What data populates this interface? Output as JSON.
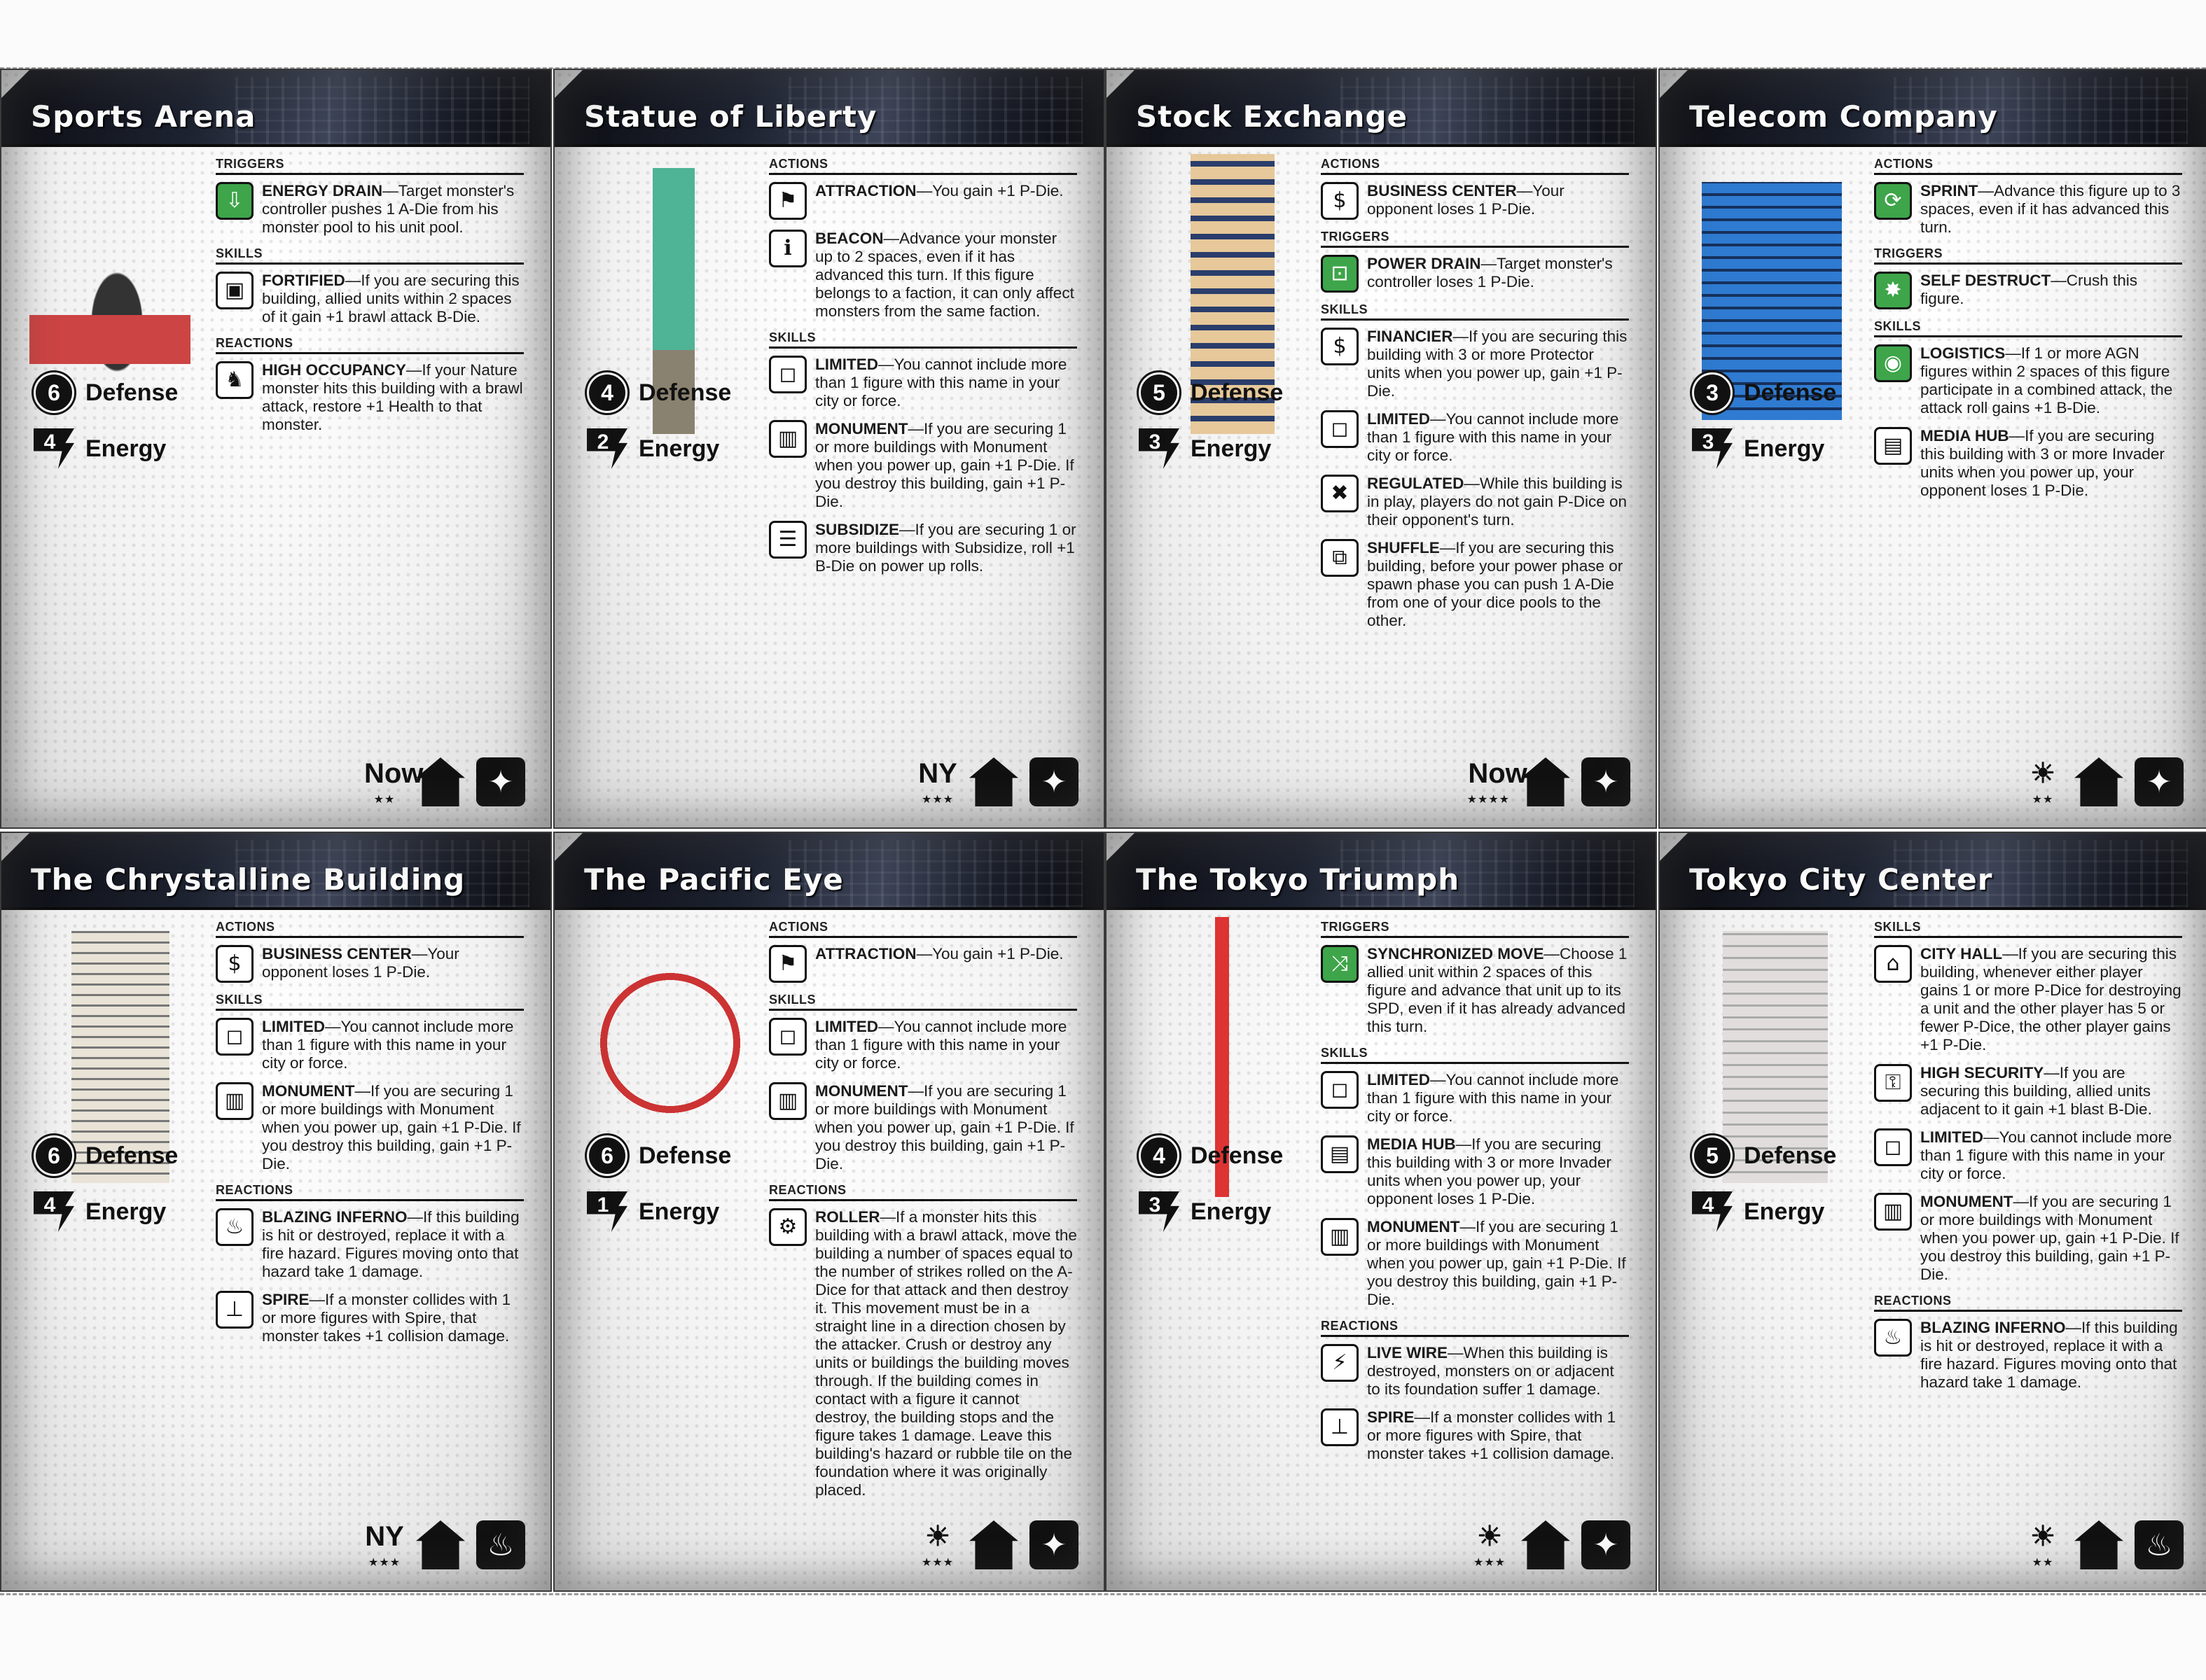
{
  "cards": [
    {
      "title": "Sports Arena",
      "defense": "6",
      "defense_label": "Defense",
      "energy": "4",
      "energy_label": "Energy",
      "sections": [
        {
          "head": "TRIGGERS",
          "abilities": [
            {
              "icon": "energy-drain-icon",
              "name": "ENERGY DRAIN",
              "text": "—Target monster's controller pushes 1 A-Die from his monster pool to his unit pool."
            }
          ]
        },
        {
          "head": "SKILLS",
          "abilities": [
            {
              "icon": "fortified-icon",
              "name": "FORTIFIED",
              "text": "—If you are securing this building, allied units within 2 spaces of it gain +1 brawl attack B-Die."
            }
          ]
        },
        {
          "head": "REACTIONS",
          "abilities": [
            {
              "icon": "high-occupancy-icon",
              "name": "HIGH OCCUPANCY",
              "text": "—If your Nature monster hits this building with a brawl attack, restore +1 Health to that monster."
            }
          ]
        }
      ],
      "set_glyph": "Now",
      "set_stars": "★★",
      "type_icon": "house",
      "tile_icon": "rubble-icon"
    },
    {
      "title": "Statue of Liberty",
      "defense": "4",
      "defense_label": "Defense",
      "energy": "2",
      "energy_label": "Energy",
      "sections": [
        {
          "head": "ACTIONS",
          "abilities": [
            {
              "icon": "attraction-icon",
              "name": "ATTRACTION",
              "text": "—You gain +1 P-Die."
            },
            {
              "icon": "beacon-icon",
              "name": "BEACON",
              "text": "—Advance your monster up to 2 spaces, even if it has advanced this turn. If this figure belongs to a faction, it can only affect monsters from the same faction."
            }
          ]
        },
        {
          "head": "SKILLS",
          "abilities": [
            {
              "icon": "limited-icon",
              "name": "LIMITED",
              "text": "—You cannot include more than 1 figure with this name in your city or force."
            },
            {
              "icon": "monument-icon",
              "name": "MONUMENT",
              "text": "—If you are securing 1 or more buildings with Monument when you power up, gain +1 P-Die. If you destroy this building, gain +1 P-Die."
            },
            {
              "icon": "subsidize-icon",
              "name": "SUBSIDIZE",
              "text": "—If you are securing 1 or more buildings with Subsidize, roll +1 B-Die on power up rolls."
            }
          ]
        }
      ],
      "set_glyph": "NY",
      "set_stars": "★★★",
      "type_icon": "house",
      "tile_icon": "rubble-icon"
    },
    {
      "title": "Stock Exchange",
      "defense": "5",
      "defense_label": "Defense",
      "energy": "3",
      "energy_label": "Energy",
      "sections": [
        {
          "head": "ACTIONS",
          "abilities": [
            {
              "icon": "business-center-icon",
              "name": "BUSINESS CENTER",
              "text": "—Your opponent loses 1 P-Die."
            }
          ]
        },
        {
          "head": "TRIGGERS",
          "abilities": [
            {
              "icon": "power-drain-icon",
              "name": "POWER DRAIN",
              "text": "—Target monster's controller loses 1 P-Die."
            }
          ]
        },
        {
          "head": "SKILLS",
          "abilities": [
            {
              "icon": "financier-icon",
              "name": "FINANCIER",
              "text": "—If you are securing this building with 3 or more Protector units when you power up, gain +1 P-Die."
            },
            {
              "icon": "limited-icon",
              "name": "LIMITED",
              "text": "—You cannot include more than 1 figure with this name in your city or force."
            },
            {
              "icon": "regulated-icon",
              "name": "REGULATED",
              "text": "—While this building is in play, players do not gain P-Dice on their opponent's turn."
            },
            {
              "icon": "shuffle-icon",
              "name": "SHUFFLE",
              "text": "—If you are securing this building, before your power phase or spawn phase you can push 1 A-Die from one of your dice pools to the other."
            }
          ]
        }
      ],
      "set_glyph": "Now",
      "set_stars": "★★★★",
      "type_icon": "house",
      "tile_icon": "rubble-icon"
    },
    {
      "title": "Telecom Company",
      "defense": "3",
      "defense_label": "Defense",
      "energy": "3",
      "energy_label": "Energy",
      "sections": [
        {
          "head": "ACTIONS",
          "abilities": [
            {
              "icon": "sprint-icon",
              "name": "SPRINT",
              "text": "—Advance this figure up to 3 spaces, even if it has advanced this turn."
            }
          ]
        },
        {
          "head": "TRIGGERS",
          "abilities": [
            {
              "icon": "self-destruct-icon",
              "name": "SELF DESTRUCT",
              "text": "—Crush this figure."
            }
          ]
        },
        {
          "head": "SKILLS",
          "abilities": [
            {
              "icon": "logistics-icon",
              "name": "LOGISTICS",
              "text": "—If 1 or more AGN figures within 2 spaces of this figure participate in a combined attack, the attack roll gains +1 B-Die."
            },
            {
              "icon": "media-hub-icon",
              "name": "MEDIA HUB",
              "text": "—If you are securing this building with 3 or more Invader units when you power up, your opponent loses 1 P-Die."
            }
          ]
        }
      ],
      "set_glyph": "☀",
      "set_stars": "★★",
      "type_icon": "house",
      "tile_icon": "rubble-icon"
    },
    {
      "title": "The Chrystalline Building",
      "defense": "6",
      "defense_label": "Defense",
      "energy": "4",
      "energy_label": "Energy",
      "sections": [
        {
          "head": "ACTIONS",
          "abilities": [
            {
              "icon": "business-center-icon",
              "name": "BUSINESS CENTER",
              "text": "—Your opponent loses 1 P-Die."
            }
          ]
        },
        {
          "head": "SKILLS",
          "abilities": [
            {
              "icon": "limited-icon",
              "name": "LIMITED",
              "text": "—You cannot include more than 1 figure with this name in your city or force."
            },
            {
              "icon": "monument-icon",
              "name": "MONUMENT",
              "text": "—If you are securing 1 or more buildings with Monument when you power up, gain +1 P-Die. If you destroy this building, gain +1 P-Die."
            }
          ]
        },
        {
          "head": "REACTIONS",
          "abilities": [
            {
              "icon": "blazing-inferno-icon",
              "name": "BLAZING INFERNO",
              "text": "—If this building is hit or destroyed, replace it with a fire hazard. Figures moving onto that hazard take 1 damage."
            },
            {
              "icon": "spire-icon",
              "name": "SPIRE",
              "text": "—If a monster collides with 1 or more figures with Spire, that monster takes +1 collision damage."
            }
          ]
        }
      ],
      "set_glyph": "NY",
      "set_stars": "★★★",
      "type_icon": "house",
      "tile_icon": "fire-icon"
    },
    {
      "title": "The Pacific Eye",
      "defense": "6",
      "defense_label": "Defense",
      "energy": "1",
      "energy_label": "Energy",
      "sections": [
        {
          "head": "ACTIONS",
          "abilities": [
            {
              "icon": "attraction-icon",
              "name": "ATTRACTION",
              "text": "—You gain +1 P-Die."
            }
          ]
        },
        {
          "head": "SKILLS",
          "abilities": [
            {
              "icon": "limited-icon",
              "name": "LIMITED",
              "text": "—You cannot include more than 1 figure with this name in your city or force."
            },
            {
              "icon": "monument-icon",
              "name": "MONUMENT",
              "text": "—If you are securing 1 or more buildings with Monument when you power up, gain +1 P-Die. If you destroy this building, gain +1 P-Die."
            }
          ]
        },
        {
          "head": "REACTIONS",
          "abilities": [
            {
              "icon": "roller-icon",
              "name": "ROLLER",
              "text": "—If a monster hits this building with a brawl attack, move the building a number of spaces equal to the number of strikes rolled on the A-Dice for that attack and then destroy it. This movement must be in a straight line in a direction chosen by the attacker. Crush or destroy any units or buildings the building moves through. If the building comes in contact with a figure it cannot destroy, the building stops and the figure takes 1 damage. Leave this building's hazard or rubble tile on the foundation where it was originally placed."
            }
          ]
        }
      ],
      "set_glyph": "☀",
      "set_stars": "★★★",
      "type_icon": "house",
      "tile_icon": "rubble-icon"
    },
    {
      "title": "The Tokyo Triumph",
      "defense": "4",
      "defense_label": "Defense",
      "energy": "3",
      "energy_label": "Energy",
      "sections": [
        {
          "head": "TRIGGERS",
          "abilities": [
            {
              "icon": "synchronized-move-icon",
              "name": "SYNCHRONIZED MOVE",
              "text": "—Choose 1 allied unit within 2 spaces of this figure and advance that unit up to its SPD, even if it has already advanced this turn."
            }
          ]
        },
        {
          "head": "SKILLS",
          "abilities": [
            {
              "icon": "limited-icon",
              "name": "LIMITED",
              "text": "—You cannot include more than 1 figure with this name in your city or force."
            },
            {
              "icon": "media-hub-icon",
              "name": "MEDIA HUB",
              "text": "—If you are securing this building with 3 or more Invader units when you power up, your opponent loses 1 P-Die."
            },
            {
              "icon": "monument-icon",
              "name": "MONUMENT",
              "text": "—If you are securing 1 or more buildings with Monument when you power up, gain +1 P-Die. If you destroy this building, gain +1 P-Die."
            }
          ]
        },
        {
          "head": "REACTIONS",
          "abilities": [
            {
              "icon": "live-wire-icon",
              "name": "LIVE WIRE",
              "text": "—When this building is destroyed, monsters on or adjacent to its foundation suffer 1 damage."
            },
            {
              "icon": "spire-icon",
              "name": "SPIRE",
              "text": "—If a monster collides with 1 or more figures with Spire, that monster takes +1 collision damage."
            }
          ]
        }
      ],
      "set_glyph": "☀",
      "set_stars": "★★★",
      "type_icon": "house",
      "tile_icon": "rubble-icon"
    },
    {
      "title": "Tokyo City Center",
      "defense": "5",
      "defense_label": "Defense",
      "energy": "4",
      "energy_label": "Energy",
      "sections": [
        {
          "head": "SKILLS",
          "abilities": [
            {
              "icon": "city-hall-icon",
              "name": "CITY HALL",
              "text": "—If you are securing this building, whenever either player gains 1 or more P-Dice for destroying a unit and the other player has 5 or fewer P-Dice, the other player gains +1 P-Die."
            },
            {
              "icon": "high-security-icon",
              "name": "HIGH SECURITY",
              "text": "—If you are securing this building, allied units adjacent to it gain +1 blast B-Die."
            },
            {
              "icon": "limited-icon",
              "name": "LIMITED",
              "text": "—You cannot include more than 1 figure with this name in your city or force."
            },
            {
              "icon": "monument-icon",
              "name": "MONUMENT",
              "text": "—If you are securing 1 or more buildings with Monument when you power up, gain +1 P-Die. If you destroy this building, gain +1 P-Die."
            }
          ]
        },
        {
          "head": "REACTIONS",
          "abilities": [
            {
              "icon": "blazing-inferno-icon",
              "name": "BLAZING INFERNO",
              "text": "—If this building is hit or destroyed, replace it with a fire hazard. Figures moving onto that hazard take 1 damage."
            }
          ]
        }
      ],
      "set_glyph": "☀",
      "set_stars": "★★",
      "type_icon": "house",
      "tile_icon": "fire-icon"
    }
  ]
}
